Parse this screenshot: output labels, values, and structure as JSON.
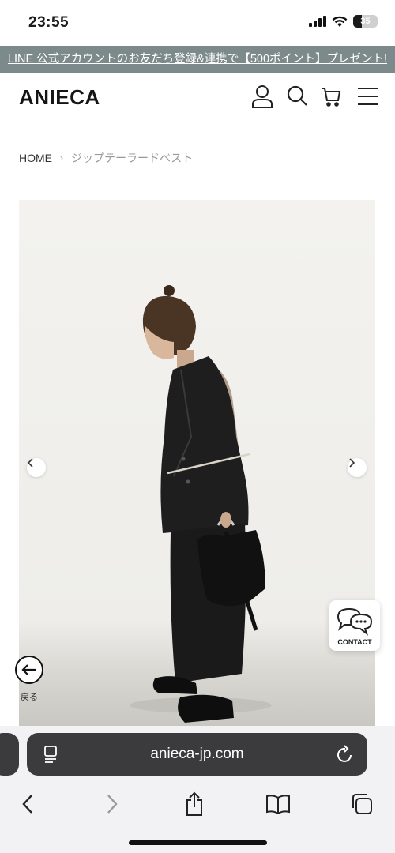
{
  "status": {
    "time": "23:55",
    "battery": "35",
    "battery_level": 0.35
  },
  "banner": {
    "text": "LINE 公式アカウントのお友だち登録&連携で【500ポイント】プレゼント!"
  },
  "header": {
    "logo": "ANIECA",
    "icons": [
      "account-icon",
      "search-icon",
      "cart-icon",
      "menu-icon"
    ]
  },
  "breadcrumb": {
    "home": "HOME",
    "separator": "›",
    "current": "ジップテーラードベスト"
  },
  "product": {
    "image_alt": "ジップテーラードベスト"
  },
  "contact": {
    "label": "CONTACT"
  },
  "back": {
    "label": "戻る"
  },
  "browser": {
    "url": "anieca-jp.com"
  },
  "colors": {
    "banner": "#7c8a8c",
    "url_bar": "#3b3b3d",
    "toolbar_bg": "#f2f2f4"
  }
}
